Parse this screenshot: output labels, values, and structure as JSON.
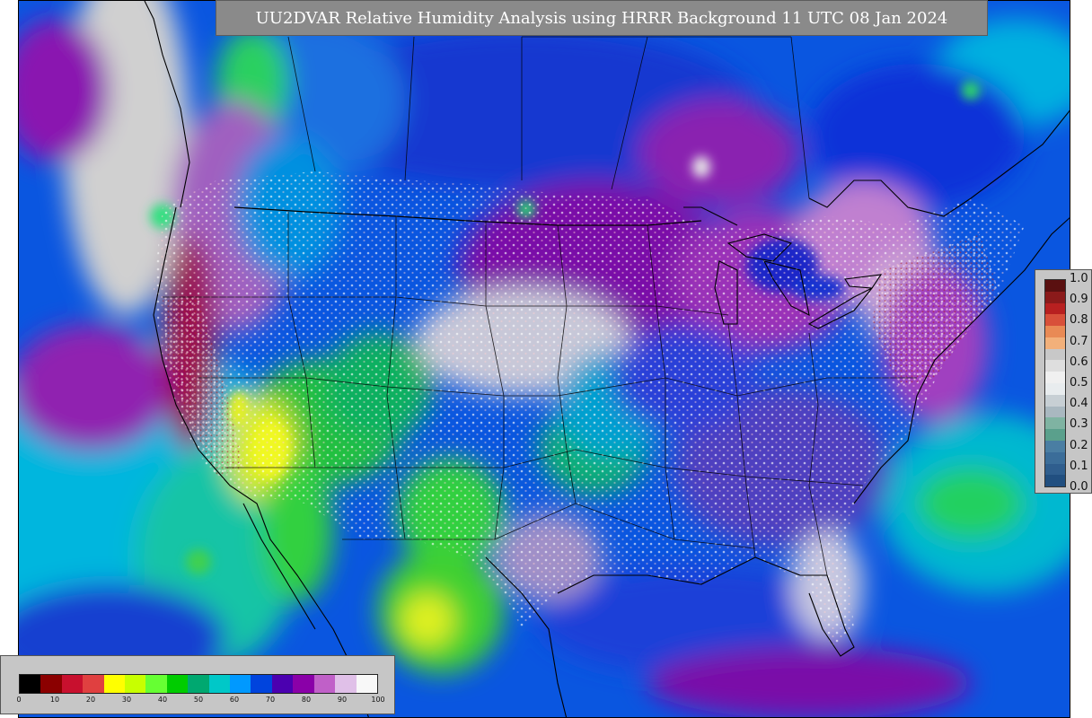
{
  "title": "UU2DVAR Relative Humidity Analysis using HRRR Background 11 UTC 08 Jan 2024",
  "observation_scale": {
    "labels": [
      "1.0",
      "0.9",
      "0.8",
      "0.7",
      "0.6",
      "0.5",
      "0.4",
      "0.3",
      "0.2",
      "0.1",
      "0.0"
    ],
    "colors": [
      "#5a1010",
      "#8b1a1a",
      "#b82020",
      "#d8503a",
      "#e98a55",
      "#f2b07a",
      "#c8c8c8",
      "#dedede",
      "#f0f0f0",
      "#e8ecee",
      "#c7cfd4",
      "#a9b8c0",
      "#7fb3a2",
      "#5aa08c",
      "#4a7ea3",
      "#3b6d99",
      "#2f5e8e",
      "#214f80"
    ]
  },
  "rh_scale": {
    "labels": [
      "0",
      "10",
      "20",
      "30",
      "40",
      "50",
      "60",
      "70",
      "80",
      "90",
      "100"
    ],
    "colors": [
      "#000000",
      "#8b0000",
      "#c8102e",
      "#e04040",
      "#ffff00",
      "#c8ff00",
      "#66ff33",
      "#00cc00",
      "#00a870",
      "#00c8c8",
      "#0099ff",
      "#0044dd",
      "#4b00b0",
      "#8a00a8",
      "#c060c8",
      "#e0c0e8",
      "#f8f8f8"
    ]
  },
  "map": {
    "region": "CONUS",
    "colors": {
      "ocean_blue": "#1060e0",
      "moist_purple": "#7a10a8",
      "saturated": "#cfcfcf",
      "dry_green": "#22cc33",
      "very_dry_yellow": "#e0f020",
      "deep_blue": "#1a2ed0",
      "cyan": "#00b8e0"
    }
  }
}
